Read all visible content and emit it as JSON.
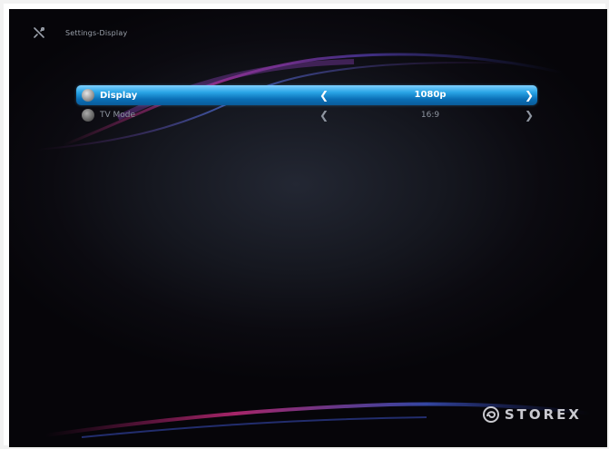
{
  "header": {
    "breadcrumb": "Settings-Display"
  },
  "menu": {
    "items": [
      {
        "label": "Display",
        "value": "1080p",
        "selected": true
      },
      {
        "label": "TV Mode",
        "value": "16:9",
        "selected": false
      }
    ]
  },
  "brand": {
    "name": "STOREX"
  },
  "icons": {
    "header": "tools-icon",
    "display_row": "display-settings-icon",
    "tvmode_row": "tv-mode-icon",
    "prev": "chevron-left-icon",
    "next": "chevron-right-icon",
    "logo": "storex-logo-icon"
  },
  "colors": {
    "selection": "#1e8fd3",
    "background": "#0c0b12",
    "text_dim": "#8e95a0",
    "accent_purple": "#8a2a8c"
  }
}
